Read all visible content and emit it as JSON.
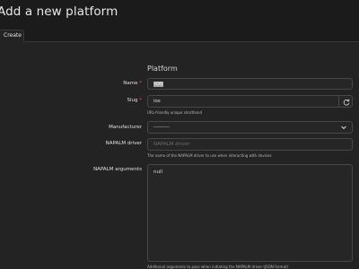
{
  "header": {
    "title": "Add a new platform"
  },
  "tabs": [
    {
      "label": "Create"
    }
  ],
  "form": {
    "section_title": "Platform",
    "name": {
      "label": "Name",
      "required_mark": "*",
      "value": "iOS"
    },
    "slug": {
      "label": "Slug",
      "required_mark": "*",
      "value": "ios",
      "help": "URL-friendly unique shorthand",
      "regenerate_icon": "refresh-icon"
    },
    "manufacturer": {
      "label": "Manufacturer",
      "selected": "---------",
      "icon": "chevron-down-icon"
    },
    "napalm_driver": {
      "label": "NAPALM driver",
      "placeholder": "NAPALM driver",
      "help": "The name of the NAPALM driver to use when interacting with devices"
    },
    "napalm_args": {
      "label": "NAPALM arguments",
      "value": "null",
      "help": "Additional arguments to pass when initiating the NAPALM driver (JSON format)"
    }
  },
  "colors": {
    "background": "#1b1b1b",
    "card": "#232323",
    "input_border": "#474747",
    "required": "#e06060"
  }
}
